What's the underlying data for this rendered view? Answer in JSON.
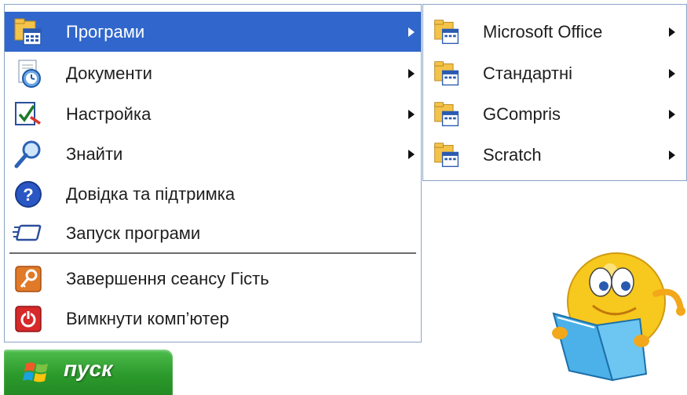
{
  "start_menu": {
    "items": [
      {
        "label": "Програми",
        "has_submenu": true,
        "active": true,
        "icon": "programs-folder-icon"
      },
      {
        "label": "Документи",
        "has_submenu": true,
        "icon": "documents-icon"
      },
      {
        "label": "Настройка",
        "has_submenu": true,
        "icon": "settings-icon"
      },
      {
        "label": "Знайти",
        "has_submenu": true,
        "icon": "search-icon"
      },
      {
        "label": "Довідка та підтримка",
        "icon": "help-icon"
      },
      {
        "label": "Запуск програми",
        "icon": "run-icon"
      },
      {
        "label": "Завершення сеансу Гість",
        "icon": "logoff-icon"
      },
      {
        "label": "Вимкнути комп’ютер",
        "icon": "power-icon"
      }
    ]
  },
  "submenu": {
    "items": [
      {
        "label": "Microsoft Office",
        "icon": "program-folder-icon"
      },
      {
        "label": "Стандартні",
        "icon": "program-folder-icon"
      },
      {
        "label": "GCompris",
        "icon": "program-folder-icon"
      },
      {
        "label": "Scratch",
        "icon": "program-folder-icon"
      }
    ]
  },
  "start_button": {
    "label": "пуск"
  },
  "colors": {
    "highlight": "#3167cc",
    "start_green": "#2c9a2c",
    "menu_border": "#8aa4c8"
  }
}
